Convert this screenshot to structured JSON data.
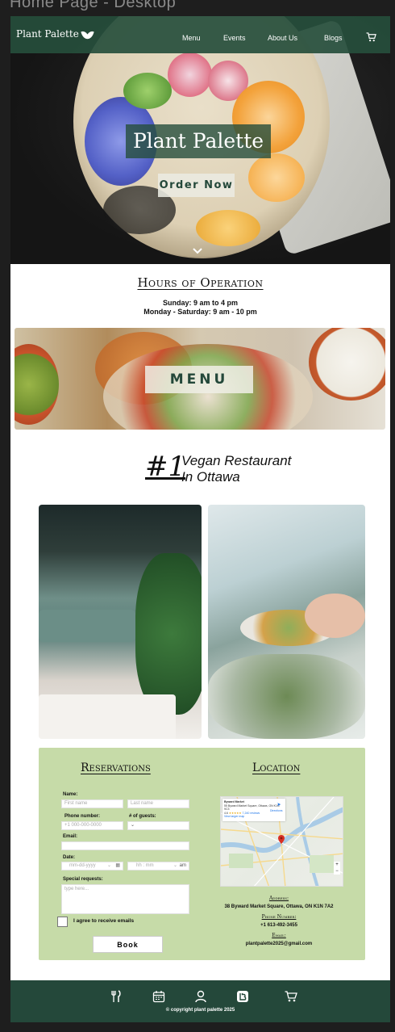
{
  "frame_label": "Home Page - Desktop",
  "nav": {
    "logo": "Plant Palette",
    "items": [
      "Menu",
      "Events",
      "About Us",
      "Blogs"
    ]
  },
  "hero": {
    "title": "Plant Palette",
    "cta": "Order Now"
  },
  "hours": {
    "title": "Hours of Operation",
    "lines": [
      "Sunday:  9 am to 4 pm",
      "Monday - Saturday:  9 am - 10 pm"
    ]
  },
  "menu_banner": {
    "label": "MENU"
  },
  "feature": {
    "rank": "#1",
    "line1": "Vegan Restaurant",
    "line2": "In Ottawa"
  },
  "reservations": {
    "title": "Reservations",
    "name_label": "Name:",
    "first_placeholder": "First name",
    "last_placeholder": "Last name",
    "phone_label": "Phone number:",
    "phone_placeholder": "+1 000-000-0000",
    "guests_label": "# of guests:",
    "email_label": "Email:",
    "date_label": "Date:",
    "date_placeholder": "mm-dd-yyyy",
    "time_placeholder": "hh : mm",
    "ampm": "am",
    "requests_label": "Special requests:",
    "requests_placeholder": "type here...",
    "consent": "I agree to receive emails",
    "book": "Book"
  },
  "location": {
    "title": "Location",
    "map_place": "Byward Market",
    "map_address": "55 Byward Market Square, Ottawa, ON K1N 9C3",
    "map_rating": "4.6",
    "map_reviews": "7,240 reviews",
    "map_link": "View larger map",
    "map_directions": "Directions",
    "address_label": "Address:",
    "address": "38 Byward Market Square, Ottawa, ON K1N 7A2",
    "phone_label": "Phone Number:",
    "phone": "+1 613-492-3455",
    "email_label": "Email:",
    "email": "plantpalette2025@gmail.com"
  },
  "footer": {
    "copyright": "© copyright plant palette 2025",
    "icons": [
      "utensils-icon",
      "calendar-icon",
      "user-icon",
      "blog-icon",
      "cart-icon"
    ]
  },
  "colors": {
    "brand_green": "#24483a",
    "panel_green": "#c6dba8"
  }
}
